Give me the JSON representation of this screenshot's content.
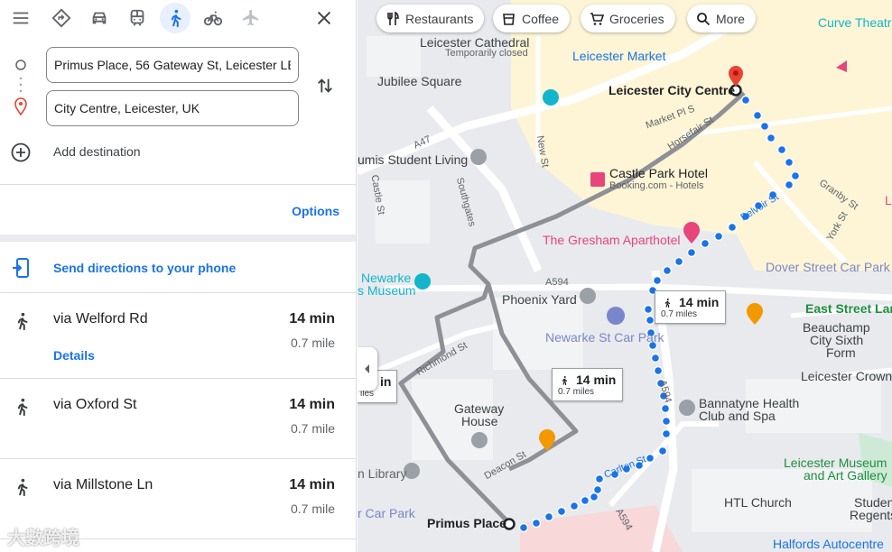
{
  "travel_modes": [
    {
      "name": "menu",
      "icon": "menu-icon"
    },
    {
      "name": "best",
      "icon": "best-route-icon"
    },
    {
      "name": "driving",
      "icon": "car-icon"
    },
    {
      "name": "transit",
      "icon": "train-icon"
    },
    {
      "name": "walking",
      "icon": "walk-icon",
      "active": true
    },
    {
      "name": "cycling",
      "icon": "bicycle-icon"
    },
    {
      "name": "flights",
      "icon": "plane-icon"
    }
  ],
  "origin": {
    "value": "Primus Place, 56 Gateway St, Leicester LE2 7DP, UK"
  },
  "destination": {
    "value": "City Centre, Leicester, UK"
  },
  "add_destination": "Add destination",
  "options_label": "Options",
  "send_to_phone": "Send directions to your phone",
  "routes": [
    {
      "via": "via Welford Rd",
      "time": "14 min",
      "distance": "0.7 mile",
      "details": "Details"
    },
    {
      "via": "via Oxford St",
      "time": "14 min",
      "distance": "0.7 mile"
    },
    {
      "via": "via Millstone Ln",
      "time": "14 min",
      "distance": "0.7 mile"
    }
  ],
  "map": {
    "chips": [
      "Restaurants",
      "Coffee",
      "Groceries",
      "More"
    ],
    "labels": {
      "leicester_cathedral": "Leicester Cathedral",
      "temporarily_closed": "Temporarily closed",
      "leicester_market": "Leicester Market",
      "curve_theatre": "Curve Theatr",
      "jubilee_square": "Jubilee Square",
      "leicester_city_centre": "Leicester City Centre",
      "market_pl_s": "Market Pl S",
      "horsefair_st": "Horsefair St",
      "a47": "A47",
      "new_st": "New St",
      "umis": "umis Student Living",
      "castle_st": "Castle St",
      "southgates": "Southgates",
      "castle_park_hotel": "Castle Park Hotel",
      "booking": "Booking.com - Hotels",
      "granby_st": "Granby St",
      "belvoir_st": "Belvoir St",
      "york_st": "York St",
      "gresham": "The Gresham Aparthotel",
      "newarke": "Newarke",
      "s_museum": "s Museum",
      "a594_1": "A594",
      "dover_street": "Dover Street Car Park",
      "east_street": "East Street Lane",
      "phoenix_yard": "Phoenix Yard",
      "beauchamp": "Beauchamp",
      "city_sixth": "City Sixth",
      "form": "Form",
      "newarke_car_park": "Newarke St Car Park",
      "richmond_st": "Richmond St",
      "leicester_crown": "Leicester Crown",
      "a594_2": "A594",
      "gateway": "Gateway",
      "house": "House",
      "bannatyne": "Bannatyne Health",
      "club_spa": "Club and Spa",
      "deacon_st": "Deacon St",
      "carlton_st": "Carlton St",
      "library": "n Library",
      "leicester_gallery_1": "Leicester Museum",
      "leicester_gallery_2": "and Art Gallery",
      "htl": "HTL Church",
      "student": "Student",
      "regents": "Regents",
      "car_park": "r Car Park",
      "primus_place": "Primus Place",
      "a594_3": "A594",
      "halfords": "Halfords Autocentre",
      "l_right": "L"
    },
    "time_boxes": [
      {
        "time": "14 min",
        "distance": "0.7 miles"
      },
      {
        "time": "14 min",
        "distance": "0.7 miles"
      },
      {
        "time": "in",
        "distance": "iles"
      }
    ],
    "watermark": "大數跨境"
  },
  "colors": {
    "accent": "#1a73e8",
    "route": "#1a73e8",
    "alt_route": "#8e9095",
    "pin": "#ea4335"
  }
}
